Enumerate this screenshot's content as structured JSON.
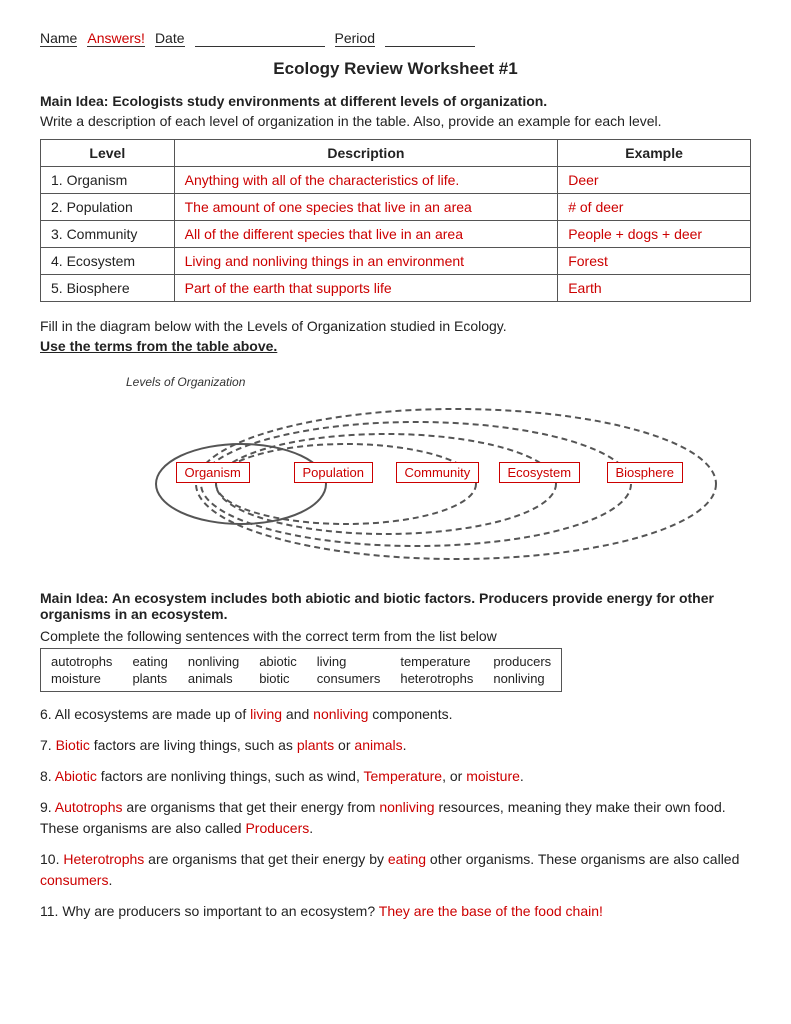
{
  "header": {
    "name_label": "Name",
    "answers_label": "Answers!",
    "date_label": "Date",
    "period_label": "Period"
  },
  "title": "Ecology Review Worksheet #1",
  "section1": {
    "main_idea": "Main Idea:  Ecologists study environments at different levels of organization.",
    "instruction": "Write a description of each level of organization in the table.  Also, provide an example for each level.",
    "table": {
      "headers": [
        "Level",
        "Description",
        "Example"
      ],
      "rows": [
        {
          "level": "1. Organism",
          "description": "Anything with all of the characteristics of life.",
          "example": "Deer"
        },
        {
          "level": "2. Population",
          "description": "The amount of one species that live in an area",
          "example": "# of deer"
        },
        {
          "level": "3. Community",
          "description": "All of the different species that live in an area",
          "example": "People + dogs  + deer"
        },
        {
          "level": "4. Ecosystem",
          "description": "Living and nonliving things in an environment",
          "example": "Forest"
        },
        {
          "level": "5. Biosphere",
          "description": "Part of the earth that supports life",
          "example": "Earth"
        }
      ]
    }
  },
  "diagram_section": {
    "instruction1": "Fill in the diagram below with the Levels of Organization studied in Ecology.",
    "instruction2": "Use the terms from the table above.",
    "diagram_label": "Levels of Organization",
    "labels": [
      "Organism",
      "Population",
      "Community",
      "Ecosystem",
      "Biosphere"
    ]
  },
  "section2": {
    "main_idea": "Main Idea:  An ecosystem includes both abiotic and biotic factors.  Producers provide energy for other organisms in an ecosystem.",
    "instruction": "Complete the following sentences with the correct term from the list below",
    "word_bank": [
      "autotrophs",
      "eating",
      "nonliving",
      "abiotic",
      "living",
      "temperature",
      "producers",
      "moisture",
      "plants",
      "animals",
      "biotic",
      "consumers",
      "heterotrophs",
      "nonliving"
    ],
    "sentences": [
      {
        "num": "6.",
        "parts": [
          {
            "text": " All ecosystems are made up of ",
            "red": false
          },
          {
            "text": "living",
            "red": true
          },
          {
            "text": " and ",
            "red": false
          },
          {
            "text": "nonliving",
            "red": true
          },
          {
            "text": " components.",
            "red": false
          }
        ]
      },
      {
        "num": "7.",
        "parts": [
          {
            "text": " ",
            "red": false
          },
          {
            "text": "Biotic",
            "red": true
          },
          {
            "text": " factors are living things, such as ",
            "red": false
          },
          {
            "text": "plants",
            "red": true
          },
          {
            "text": " or ",
            "red": false
          },
          {
            "text": "animals",
            "red": true
          },
          {
            "text": ".",
            "red": false
          }
        ]
      },
      {
        "num": "8.",
        "parts": [
          {
            "text": " ",
            "red": false
          },
          {
            "text": "Abiotic",
            "red": true
          },
          {
            "text": " factors are nonliving things, such as wind, ",
            "red": false
          },
          {
            "text": "Temperature",
            "red": true
          },
          {
            "text": ", or ",
            "red": false
          },
          {
            "text": "moisture",
            "red": true
          },
          {
            "text": ".",
            "red": false
          }
        ]
      },
      {
        "num": "9.",
        "parts": [
          {
            "text": " ",
            "red": false
          },
          {
            "text": "Autotrophs",
            "red": true
          },
          {
            "text": " are organisms that get their energy from ",
            "red": false
          },
          {
            "text": "nonliving",
            "red": true
          },
          {
            "text": " resources, meaning they make their own food.  These organisms are also called ",
            "red": false
          },
          {
            "text": "Producers",
            "red": true
          },
          {
            "text": ".",
            "red": false
          }
        ]
      },
      {
        "num": "10.",
        "parts": [
          {
            "text": " ",
            "red": false
          },
          {
            "text": "Heterotrophs",
            "red": true
          },
          {
            "text": " are organisms that get their energy by ",
            "red": false
          },
          {
            "text": "eating",
            "red": true
          },
          {
            "text": " other organisms.  These organisms are also called ",
            "red": false
          },
          {
            "text": "consumers",
            "red": true
          },
          {
            "text": ".",
            "red": false
          }
        ]
      },
      {
        "num": "11.",
        "parts": [
          {
            "text": " Why are producers so important to an ecosystem? ",
            "red": false
          },
          {
            "text": "They are the base of the food chain!",
            "red": true
          }
        ]
      }
    ]
  }
}
